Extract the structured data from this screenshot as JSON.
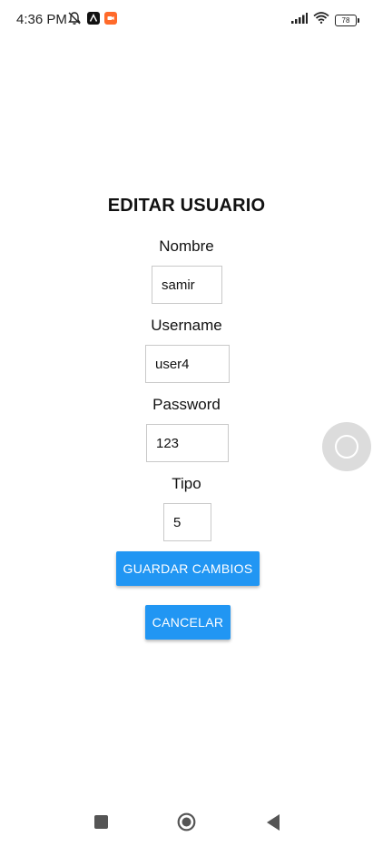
{
  "status_bar": {
    "time": "4:36 PM",
    "battery": "78"
  },
  "form": {
    "title": "EDITAR USUARIO",
    "fields": [
      {
        "label": "Nombre",
        "value": "samir"
      },
      {
        "label": "Username",
        "value": "user4"
      },
      {
        "label": "Password",
        "value": "123"
      },
      {
        "label": "Tipo",
        "value": "5"
      }
    ],
    "save_label": "GUARDAR CAMBIOS",
    "cancel_label": "CANCELAR"
  },
  "colors": {
    "accent": "#2196f3",
    "notification_app": "#ff6a2a"
  },
  "icons": {
    "status_left": [
      "mute-icon",
      "app-icon",
      "app-icon"
    ],
    "status_right": [
      "signal-icon",
      "wifi-icon",
      "battery-icon"
    ],
    "nav": [
      "recent-apps-icon",
      "home-icon",
      "back-icon"
    ],
    "floating": "assistive-touch-icon"
  }
}
